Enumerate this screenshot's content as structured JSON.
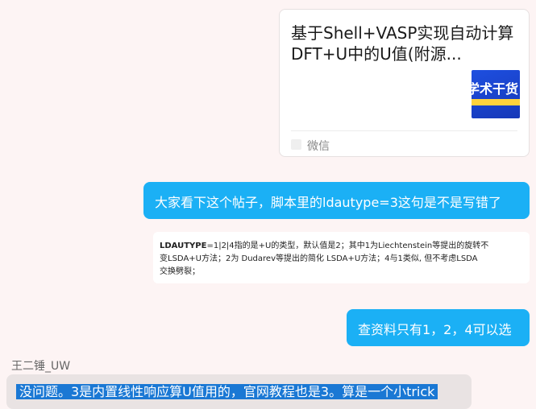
{
  "link_card": {
    "title": "基于Shell+VASP实现自动计算DFT+U中的U值(附源...",
    "thumbnail_text": "学术干货",
    "source_icon": "app-icon",
    "source": "微信"
  },
  "messages": [
    {
      "text": "大家看下这个帖子，脚本里的ldautype=3这句是不是写错了"
    },
    {
      "quote_key": "LDAUTYPE",
      "quote_line1_rest": "=1|2|4指的是+U的类型，默认值是2；其中1为Liechtenstein等提出的旋转不",
      "quote_line2": "变LSDA+U方法；2为 Dudarev等提出的简化 LSDA+U方法；4与1类似, 但不考虑LSDA",
      "quote_line3": "交换劈裂；"
    },
    {
      "text": "查资料只有1，2，4可以选"
    }
  ],
  "reply": {
    "sender": "王二锤_UW",
    "text": "没问题。3是内置线性响应算U值用的，官网教程也是3。算是一个小trick"
  },
  "colors": {
    "bubble_blue": "#1bb0f5",
    "selection": "#1a78d4",
    "background": "#fdf4f4"
  }
}
